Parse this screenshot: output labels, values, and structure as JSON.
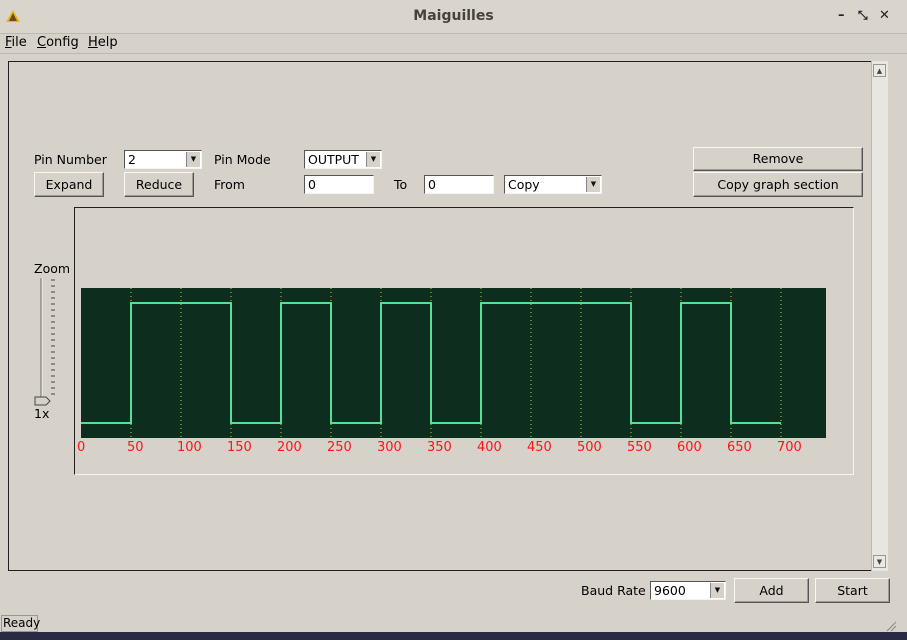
{
  "window": {
    "title": "Maiguilles"
  },
  "menu": [
    {
      "label": "File",
      "mnemonic": "F",
      "rest": "ile"
    },
    {
      "label": "Config",
      "mnemonic": "C",
      "rest": "onfig"
    },
    {
      "label": "Help",
      "mnemonic": "H",
      "rest": "elp"
    }
  ],
  "controls": {
    "pin_number_label": "Pin Number",
    "pin_number_value": "2",
    "pin_mode_label": "Pin Mode",
    "pin_mode_value": "OUTPUT",
    "remove_label": "Remove",
    "expand_label": "Expand",
    "reduce_label": "Reduce",
    "from_label": "From",
    "from_value": "0",
    "to_label": "To",
    "to_value": "0",
    "action_value": "Copy",
    "copy_section_label": "Copy graph section"
  },
  "zoom": {
    "label": "Zoom",
    "value": "1x"
  },
  "bottom": {
    "baud_label": "Baud Rate",
    "baud_value": "9600",
    "add_label": "Add",
    "start_label": "Start"
  },
  "status": {
    "text": "Ready"
  },
  "chart_data": {
    "type": "line",
    "step": true,
    "x_ticks": [
      0,
      50,
      100,
      150,
      200,
      250,
      300,
      350,
      400,
      450,
      500,
      550,
      600,
      650,
      700
    ],
    "xlim": [
      0,
      745
    ],
    "ylim": [
      0,
      1
    ],
    "grid": true,
    "background": "#0d2e1f",
    "line_color": "#55e098",
    "grid_color": "#c8d020",
    "tick_color": "#ff1414",
    "series": [
      {
        "x": [
          0,
          50,
          150,
          200,
          250,
          300,
          350,
          400,
          550,
          600,
          650,
          700
        ],
        "y": [
          0,
          1,
          0,
          1,
          0,
          1,
          0,
          1,
          0,
          1,
          0,
          0
        ]
      }
    ]
  }
}
